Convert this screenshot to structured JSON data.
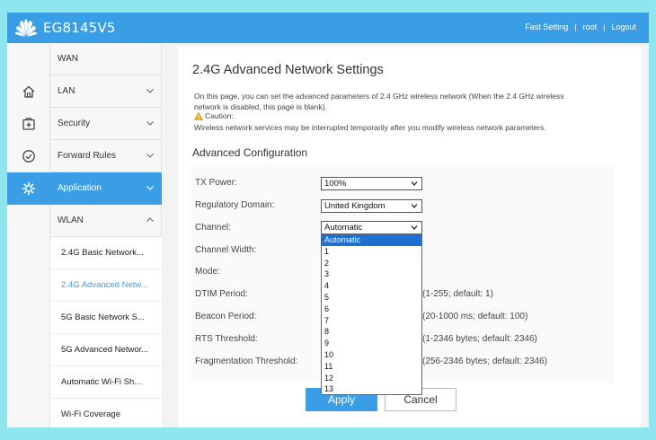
{
  "header": {
    "brand": "EG8145V5",
    "links": [
      "Fast Setting",
      "root",
      "Logout"
    ],
    "accent": "#3a9ee6"
  },
  "icons": [
    "home-icon",
    "add-box-icon",
    "check-circle-icon",
    "gear-icon"
  ],
  "menu": {
    "items": [
      "WAN",
      "LAN",
      "Security",
      "Forward Rules",
      "Application",
      "WLAN"
    ],
    "active": "Application",
    "wlan_sub": [
      "2.4G Basic Network...",
      "2.4G Advanced Netw...",
      "5G Basic Network S...",
      "5G Advanced Networ...",
      "Automatic Wi-Fi Sh...",
      "Wi-Fi Coverage"
    ],
    "active_sub": "2.4G Advanced Netw..."
  },
  "page": {
    "title": "2.4G Advanced Network Settings",
    "description": "On this page, you can set the advanced parameters of 2.4 GHz wireless network (When the 2.4 GHz wireless network is disabled, this page is blank).",
    "caution_label": "Caution:",
    "caution_text": "Wireless network services may be interrupted temporarily after you modify wireless network parameters.",
    "section": "Advanced Configuration"
  },
  "form": {
    "tx_power": {
      "label": "TX Power:",
      "value": "100%"
    },
    "regulatory_domain": {
      "label": "Regulatory Domain:",
      "value": "United Kingdom"
    },
    "channel": {
      "label": "Channel:",
      "value": "Automatic"
    },
    "channel_width": {
      "label": "Channel Width:"
    },
    "mode": {
      "label": "Mode:"
    },
    "dtim_period": {
      "label": "DTIM Period:",
      "hint": "(1-255; default: 1)"
    },
    "beacon_period": {
      "label": "Beacon Period:",
      "hint": "(20-1000 ms; default: 100)"
    },
    "rts_threshold": {
      "label": "RTS Threshold:",
      "hint": "(1-2346 bytes; default: 2346)"
    },
    "fragmentation_threshold": {
      "label": "Fragmentation Threshold:",
      "hint": "(256-2346 bytes; default: 2346)"
    }
  },
  "channel_dropdown": {
    "options": [
      "Automatic",
      "1",
      "2",
      "3",
      "4",
      "5",
      "6",
      "7",
      "8",
      "9",
      "10",
      "11",
      "12",
      "13"
    ],
    "selected": "Automatic"
  },
  "buttons": {
    "apply": "Apply",
    "cancel": "Cancel"
  }
}
